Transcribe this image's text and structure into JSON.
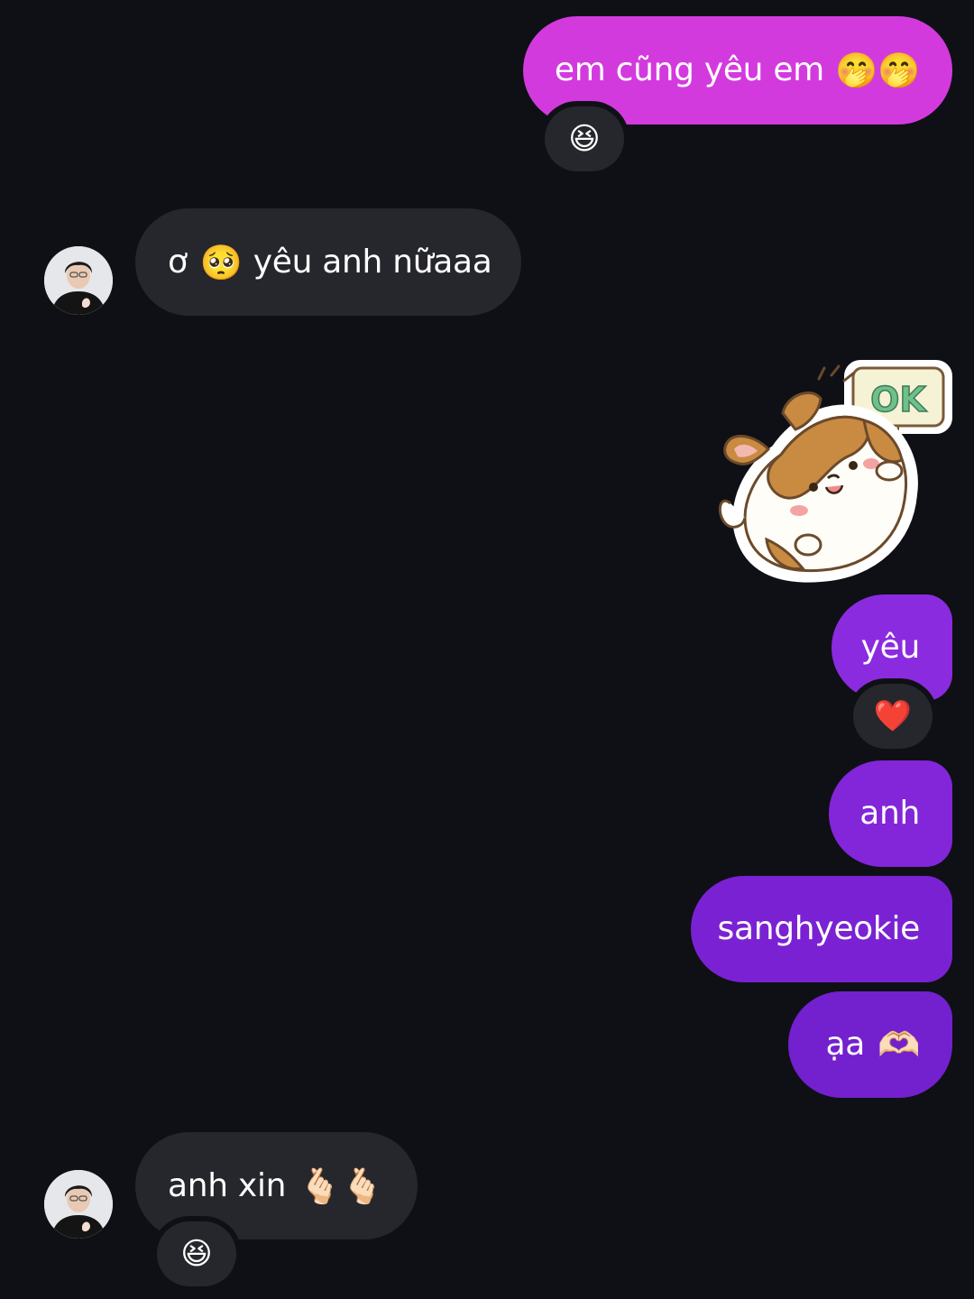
{
  "colors": {
    "background": "#0f1015",
    "received_bubble": "#26272d",
    "sent_gradient_top": "#d53ae0",
    "sent_gradient_bottom": "#6c1fc4"
  },
  "messages": [
    {
      "direction": "sent",
      "text": "em cũng yêu em",
      "emoji": "🤭🤭",
      "reaction": "😆"
    },
    {
      "direction": "received",
      "prefix": "ơ",
      "emoji": "🥺",
      "text": "yêu anh nữaaa"
    },
    {
      "direction": "sent",
      "type": "sticker",
      "sticker_text": "OK",
      "sticker_icon": "corgi-ok-sign-sticker"
    },
    {
      "direction": "sent",
      "text": "yêu",
      "reaction": "❤️"
    },
    {
      "direction": "sent",
      "text": "anh"
    },
    {
      "direction": "sent",
      "text": "sanghyeokie"
    },
    {
      "direction": "sent",
      "text": "ạa",
      "emoji": "🫶🏻"
    },
    {
      "direction": "received",
      "text": "anh xin",
      "emoji": "🫰🏻🫰🏻",
      "reaction": "😆"
    }
  ],
  "avatar_icon": "contact-avatar-photo"
}
